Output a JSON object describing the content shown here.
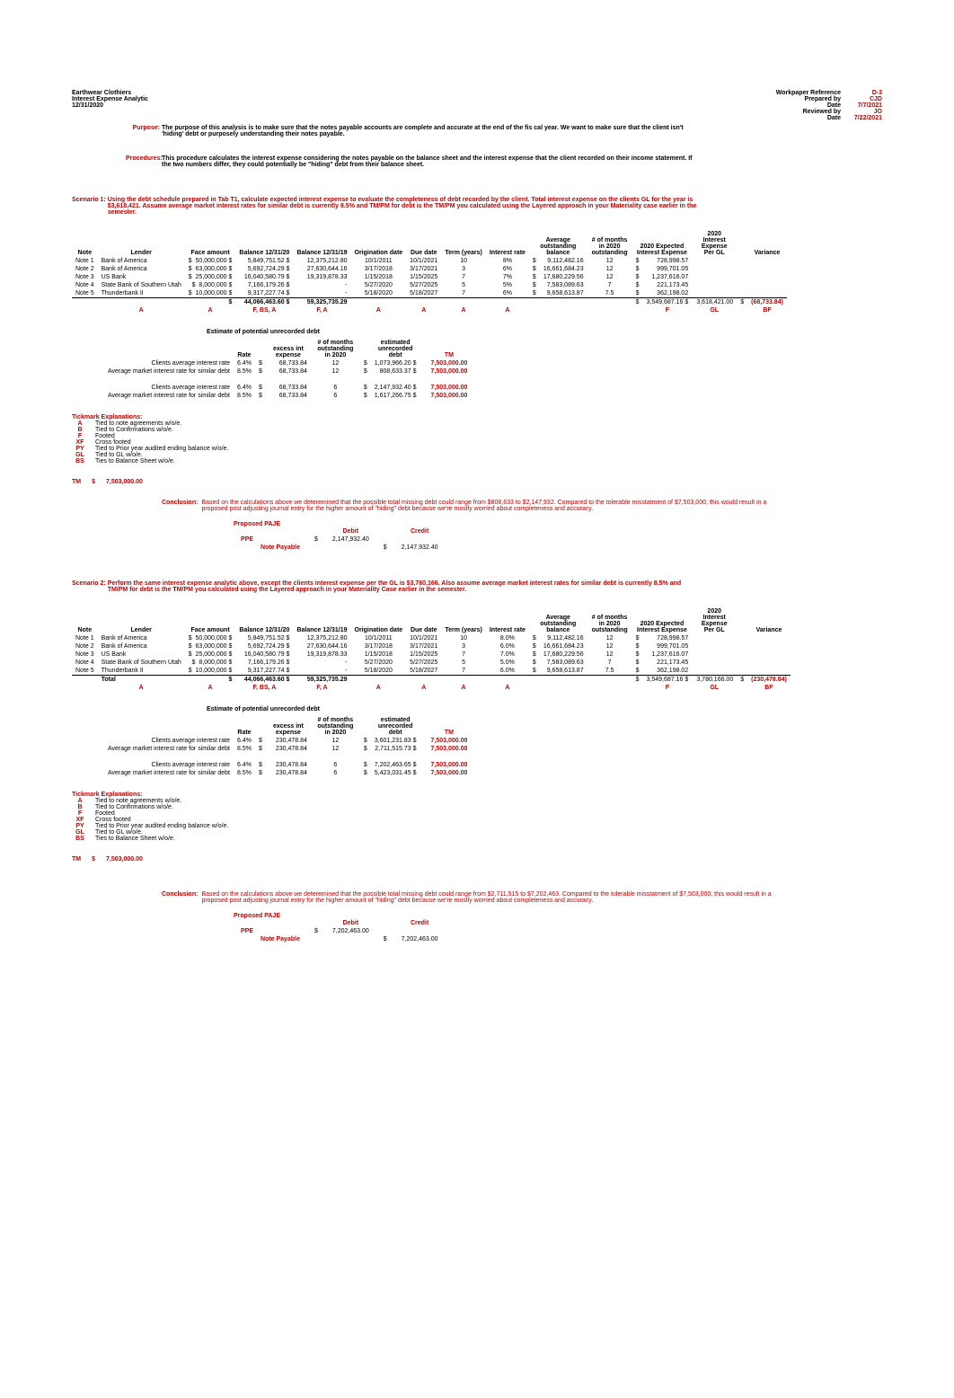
{
  "header": {
    "company": "Earthwear Clothiers",
    "subtitle": "Interest Expense Analytic",
    "date": "12/31/2020",
    "wp_ref_label": "Workpaper Reference",
    "wp_ref": "D-3",
    "prep_label": "Prepared by",
    "prep": "CJD",
    "date1_label": "Date",
    "date1": "7/7/2021",
    "rev_label": "Reviewed by",
    "rev": "JO",
    "date2_label": "Date",
    "date2": "7/22/2021"
  },
  "purpose_tag": "Purpose:",
  "purpose": "The purpose of this analysis is to make sure that the notes payable accounts are complete and accurate at the end of the fis cal year. We want to make sure that the client isn't 'hiding' debt or purposely understanding their notes payable.",
  "procedure_tag": "Procedures:",
  "procedure": "This procedure calculates the interest expense considering the notes payable on the balance sheet and the interest expense that the client recorded on their income statement. If the two numbers differ, they could potentially be \"hiding\" debt from their balance sheet.",
  "scenario1_label": "Scenario 1:",
  "scenario1_text": "Using the debt schedule prepared in Tab T1, calculate expected interest expense to evaluate the completeness of debt recorded by the client.   Total interest expense on the clients GL for the year is $3,618,421.  Assume average market interest rates for similar debt is currently 8.5% and TM/PM for debt is the TM/PM you calculated using the Layered approach in your Materiality case earlier in the semester.",
  "columns": {
    "note": "Note",
    "lender": "Lender",
    "face": "Face amount",
    "bal20": "Balance 12/31/20",
    "bal19": "Balance 12/31/19",
    "orig": "Origination date",
    "due": "Due date",
    "term": "Term (years)",
    "rate": "Interest rate",
    "avg": "Average outstanding balance",
    "months": "# of months in 2020 outstanding",
    "exp20": "2020 Expected Interest Expense",
    "gl20": "2020 Interest Expense Per GL",
    "var": "Variance"
  },
  "s1_rows": [
    {
      "note": "Note 1",
      "lender": "Bank of America",
      "face": "50,000,000",
      "bal20": "5,849,751.52",
      "bal19": "12,375,212.80",
      "orig": "10/1/2011",
      "due": "10/1/2021",
      "term": "10",
      "rate": "8%",
      "avg": "9,112,482.16",
      "months": "12",
      "exp": "728,998.57"
    },
    {
      "note": "Note 2",
      "lender": "Bank of America",
      "face": "63,000,000",
      "bal20": "5,692,724.29",
      "bal19": "27,630,644.16",
      "orig": "3/17/2018",
      "due": "3/17/2021",
      "term": "3",
      "rate": "6%",
      "avg": "16,661,684.23",
      "months": "12",
      "exp": "999,701.05"
    },
    {
      "note": "Note 3",
      "lender": "US Bank",
      "face": "25,000,000",
      "bal20": "16,040,580.79",
      "bal19": "19,319,878.33",
      "orig": "1/15/2018",
      "due": "1/15/2025",
      "term": "7",
      "rate": "7%",
      "avg": "17,680,229.56",
      "months": "12",
      "exp": "1,237,616.07"
    },
    {
      "note": "Note 4",
      "lender": "State Bank of Southern Utah",
      "face": "8,000,000",
      "bal20": "7,166,179.26",
      "bal19": "-",
      "orig": "5/27/2020",
      "due": "5/27/2025",
      "term": "5",
      "rate": "5%",
      "avg": "7,583,089.63",
      "months": "7",
      "exp": "221,173.45"
    },
    {
      "note": "Note 5",
      "lender": "Thunderbank II",
      "face": "10,000,000",
      "bal20": "9,317,227.74",
      "bal19": "-",
      "orig": "5/18/2020",
      "due": "5/18/2027",
      "term": "7",
      "rate": "6%",
      "avg": "9,658,613.87",
      "months": "7.5",
      "exp": "362,198.02"
    }
  ],
  "s1_total": {
    "bal20": "44,066,463.60",
    "bal19": "59,325,735.29",
    "exp": "3,549,687.16",
    "gl": "3,618,421.00",
    "var": "(68,733.84)"
  },
  "tick_row": {
    "a": "A",
    "fbsa": "F, BS, A",
    "fa": "F, A",
    "f": "F",
    "gl": "GL",
    "bf": "BF"
  },
  "estimate_title": "Estimate of potential unrecorded debt",
  "est_cols": {
    "rate": "Rate",
    "excess": "excess int expense",
    "months": "# of months outstanding in 2020",
    "unrec": "estimated unrecorded debt",
    "tm": "TM"
  },
  "s1_est_rows": [
    {
      "label": "Clients average interest rate",
      "rate": "6.4%",
      "excess": "68,733.84",
      "months": "12",
      "unrec": "1,073,966.20",
      "tm": "7,503,000.00"
    },
    {
      "label": "Average market interest rate for similar debt",
      "rate": "8.5%",
      "excess": "68,733.84",
      "months": "12",
      "unrec": "808,633.37",
      "tm": "7,503,000.00"
    },
    {
      "label": "Clients average interest rate",
      "rate": "6.4%",
      "excess": "68,733.84",
      "months": "6",
      "unrec": "2,147,932.40",
      "tm": "7,503,000.00"
    },
    {
      "label": "Average market interest rate for similar debt",
      "rate": "8.5%",
      "excess": "68,733.84",
      "months": "6",
      "unrec": "1,617,266.75",
      "tm": "7,503,000.00"
    }
  ],
  "tick_title": "Tickmark Explanations:",
  "ticks": [
    {
      "code": "A",
      "desc": "Tied to note agreements w/o/e."
    },
    {
      "code": "B",
      "desc": "Tied to Confirmations w/o/e."
    },
    {
      "code": "F",
      "desc": "Footed"
    },
    {
      "code": "XF",
      "desc": "Cross footed"
    },
    {
      "code": "PY",
      "desc": "Tied to Prior year audited ending balance w/o/e."
    },
    {
      "code": "GL",
      "desc": "Tied to GL w/o/e."
    },
    {
      "code": "BS",
      "desc": "Ties to Balance Sheet w/o/e."
    }
  ],
  "tm_label": "TM",
  "tm_val": "7,503,000.00",
  "conclusion_tag": "Conclusion:",
  "s1_conclusion": "Based on the calculations above we deteremined that the possible total missing debt could range from $808,633 to $2,147,932. Compared to the tolerable misstatment of $7,503,000, this would result in a proposed post adjusting journal entry for the higher amount of \"hiding\" debt because we're mostly worried about completeness and accuracy.",
  "paje_title": "Proposed PAJE",
  "debit_label": "Debit",
  "credit_label": "Credit",
  "ppe_label": "PPE",
  "np_label": "Note Payable",
  "s1_paje_amt": "2,147,932.40",
  "scenario2_label": "Scenario 2:",
  "scenario2_text": "Perform the same interest expense analytic above, except the clients interest expense per the GL is $3,780,166. Also assume average market interest rates for similar debt is currently 8.5% and TM/PM for debt is the TM/PM you calculated using the Layered approach in your Materiality Case earlier in the semester.",
  "s2_rows": [
    {
      "note": "Note 1",
      "lender": "Bank of America",
      "face": "50,000,000",
      "bal20": "5,849,751.52",
      "bal19": "12,375,212.80",
      "orig": "10/1/2011",
      "due": "10/1/2021",
      "term": "10",
      "rate": "8.0%",
      "avg": "9,112,482.16",
      "months": "12",
      "exp": "728,998.57"
    },
    {
      "note": "Note 2",
      "lender": "Bank of America",
      "face": "63,000,000",
      "bal20": "5,692,724.29",
      "bal19": "27,630,644.16",
      "orig": "3/17/2018",
      "due": "3/17/2021",
      "term": "3",
      "rate": "6.0%",
      "avg": "16,661,684.23",
      "months": "12",
      "exp": "999,701.05"
    },
    {
      "note": "Note 3",
      "lender": "US Bank",
      "face": "25,000,000",
      "bal20": "16,040,580.79",
      "bal19": "19,319,878.33",
      "orig": "1/15/2018",
      "due": "1/15/2025",
      "term": "7",
      "rate": "7.0%",
      "avg": "17,680,229.56",
      "months": "12",
      "exp": "1,237,616.07"
    },
    {
      "note": "Note 4",
      "lender": "State Bank of Southern Utah",
      "face": "8,000,000",
      "bal20": "7,166,179.26",
      "bal19": "-",
      "orig": "5/27/2020",
      "due": "5/27/2025",
      "term": "5",
      "rate": "5.0%",
      "avg": "7,583,089.63",
      "months": "7",
      "exp": "221,173.45"
    },
    {
      "note": "Note 5",
      "lender": "Thunderbank II",
      "face": "10,000,000",
      "bal20": "9,317,227.74",
      "bal19": "-",
      "orig": "5/18/2020",
      "due": "5/18/2027",
      "term": "7",
      "rate": "6.0%",
      "avg": "9,658,613.87",
      "months": "7.5",
      "exp": "362,198.02"
    }
  ],
  "s2_total": {
    "bal20": "44,066,463.60",
    "bal19": "59,325,735.29",
    "exp": "3,549,687.16",
    "gl": "3,780,166.00",
    "var": "(230,478.84)"
  },
  "s2_total_label": "Total",
  "s2_est_rows": [
    {
      "label": "Clients average interest rate",
      "rate": "6.4%",
      "excess": "230,478.84",
      "months": "12",
      "unrec": "3,601,231.83",
      "tm": "7,503,000.00"
    },
    {
      "label": "Average market interest rate for similar debt",
      "rate": "8.5%",
      "excess": "230,478.84",
      "months": "12",
      "unrec": "2,711,515.73",
      "tm": "7,503,000.00"
    },
    {
      "label": "Clients average interest rate",
      "rate": "6.4%",
      "excess": "230,478.84",
      "months": "6",
      "unrec": "7,202,463.65",
      "tm": "7,503,000.00"
    },
    {
      "label": "Average market interest rate for similar debt",
      "rate": "8.5%",
      "excess": "230,478.84",
      "months": "6",
      "unrec": "5,423,031.45",
      "tm": "7,503,000.00"
    }
  ],
  "s2_conclusion": "Based on the calculations above we deteremined that the possible total missing debt could range from $2,711,515 to $7,202,463. Compared to the tolerable misstatment of $7,503,000, this would result in a proposed post adjusting journal entry for the higher amount of \"hiding\" debt because we're mostly worried about completeness and accuracy.",
  "s2_paje_amt": "7,202,463.00",
  "dollar": "$"
}
